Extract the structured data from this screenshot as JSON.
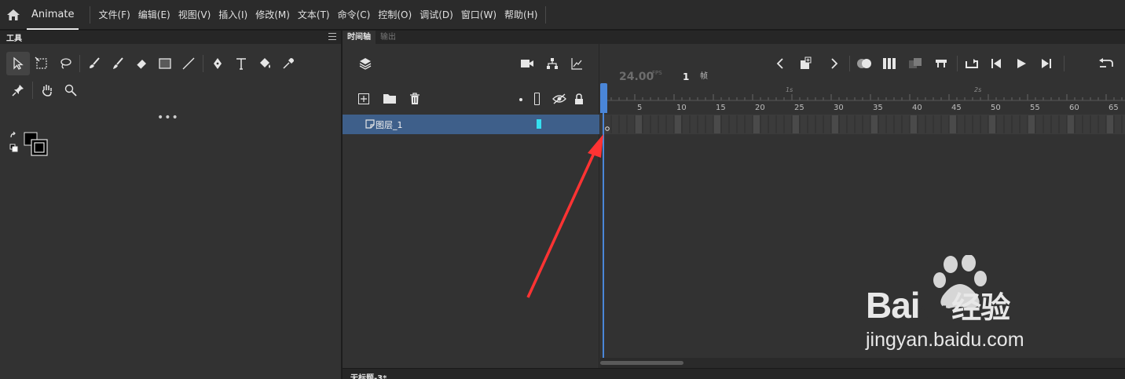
{
  "app": {
    "name": "Animate"
  },
  "menu": [
    "文件(F)",
    "编辑(E)",
    "视图(V)",
    "插入(I)",
    "修改(M)",
    "文本(T)",
    "命令(C)",
    "控制(O)",
    "调试(D)",
    "窗口(W)",
    "帮助(H)"
  ],
  "tools_panel": {
    "title": "工具",
    "more": "•••"
  },
  "timeline": {
    "tabs": [
      "时间轴",
      "输出"
    ],
    "fps_value": "24.00",
    "fps_unit": "FPS",
    "current_frame": "1",
    "frame_unit": "帧",
    "layer": {
      "name": "图层_1",
      "color": "#35e0f0"
    },
    "ruler_seconds": [
      "1s",
      "2s"
    ],
    "ruler_ticks": [
      "5",
      "10",
      "15",
      "20",
      "25",
      "30",
      "35",
      "40",
      "45",
      "50",
      "55",
      "60",
      "65"
    ]
  },
  "document_tab": {
    "label": "无标题-3*"
  },
  "watermark": {
    "brand": "Bai",
    "brand_suffix": "du",
    "cn": "经验",
    "url": "jingyan.baidu.com"
  },
  "colors": {
    "accent": "#3e5f8a",
    "playhead": "#4a86d8",
    "arrow": "#ff3333"
  }
}
